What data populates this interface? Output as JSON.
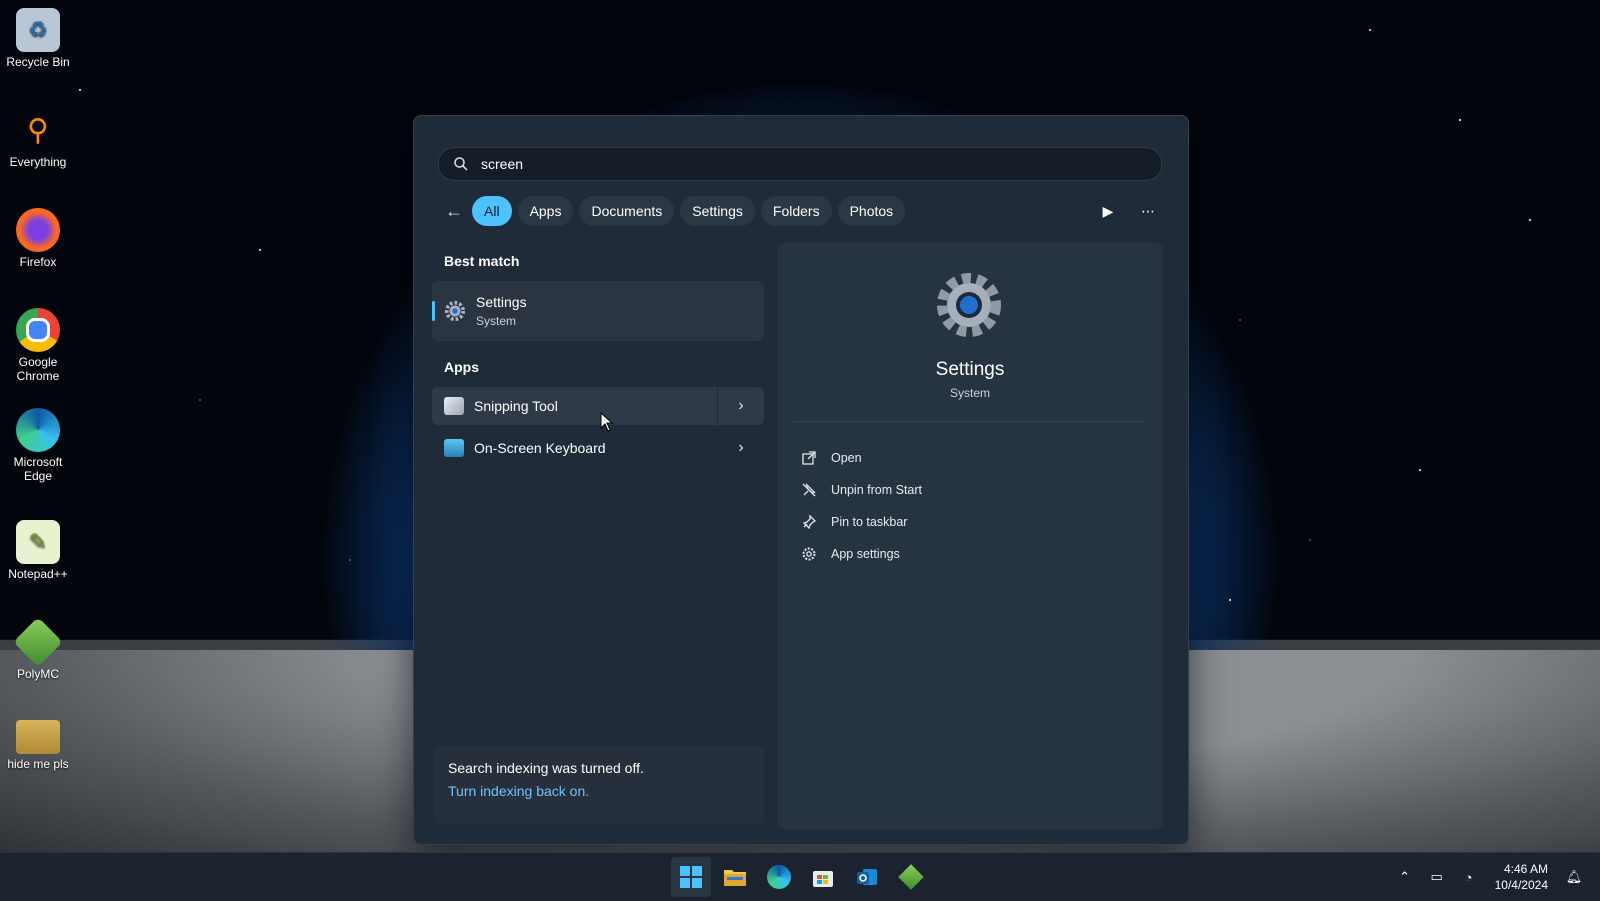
{
  "desktop": {
    "icons": [
      {
        "label": "Recycle Bin",
        "icon": "recycle-bin-icon"
      },
      {
        "label": "Everything",
        "icon": "everything-icon"
      },
      {
        "label": "Firefox",
        "icon": "firefox-icon"
      },
      {
        "label": "Google\nChrome",
        "icon": "chrome-icon"
      },
      {
        "label": "Microsoft\nEdge",
        "icon": "edge-icon"
      },
      {
        "label": "Notepad++",
        "icon": "notepadpp-icon"
      },
      {
        "label": "PolyMC",
        "icon": "polymc-icon"
      },
      {
        "label": "hide me pls",
        "icon": "folder-icon"
      }
    ]
  },
  "search": {
    "query": "screen",
    "filters": [
      "All",
      "Apps",
      "Documents",
      "Settings",
      "Folders",
      "Photos"
    ],
    "active_filter": "All"
  },
  "results": {
    "best_match_title": "Best match",
    "best_match": {
      "name": "Settings",
      "sub": "System"
    },
    "apps_title": "Apps",
    "apps": [
      {
        "name": "Snipping Tool"
      },
      {
        "name": "On-Screen Keyboard"
      }
    ]
  },
  "notice": {
    "message": "Search indexing was turned off.",
    "link": "Turn indexing back on."
  },
  "preview": {
    "title": "Settings",
    "sub": "System",
    "actions": [
      "Open",
      "Unpin from Start",
      "Pin to taskbar",
      "App settings"
    ]
  },
  "taskbar": {
    "time": "4:46 AM",
    "date": "10/4/2024"
  },
  "colors": {
    "accent": "#4cc2ff",
    "panel": "#1f2b38",
    "link": "#6fc3ff"
  }
}
